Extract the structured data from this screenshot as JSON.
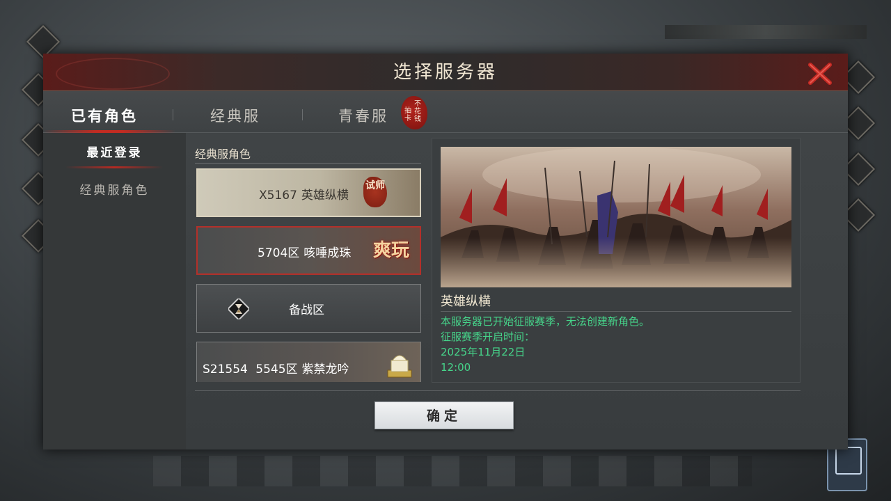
{
  "dialog": {
    "title": "选择服务器",
    "close_icon": "close-x-icon"
  },
  "tabs": [
    {
      "label": "已有角色",
      "active": true
    },
    {
      "label": "经典服",
      "active": false
    },
    {
      "label": "青春服",
      "active": false
    }
  ],
  "badge": {
    "chars": [
      "不",
      "抽",
      "花",
      "卡",
      "钱"
    ],
    "color": "#b0231c"
  },
  "sidebar": {
    "items": [
      {
        "label": "最近登录",
        "active": true
      },
      {
        "label": "经典服角色",
        "active": false
      }
    ]
  },
  "list": {
    "header": "经典服角色",
    "servers": [
      {
        "code": "X5167",
        "name": "英雄纵横",
        "stamp": "试师",
        "stamp_icon": "trial-seal-icon"
      },
      {
        "code": "5704区",
        "name": "咳唾成珠",
        "stamp": "爽玩",
        "stamp_icon": "fun-seal-icon"
      },
      {
        "code": "",
        "name": "备战区",
        "stamp": "",
        "stamp_icon": "hourglass-icon"
      },
      {
        "code": "S21554",
        "zone": "5545区",
        "name": "紫禁龙吟",
        "stamp": "",
        "stamp_icon": "jade-seal-icon"
      }
    ]
  },
  "preview": {
    "server_name": "英雄纵横",
    "lines": [
      "本服务器已开始征服赛季，无法创建新角色。",
      "征服赛季开启时间：",
      "2025年11月22日",
      "12:00"
    ],
    "text_color": "#46d48a"
  },
  "confirm_label": "确定",
  "colors": {
    "accent_red": "#c22b22",
    "dialog_bg": "#3e4244"
  }
}
